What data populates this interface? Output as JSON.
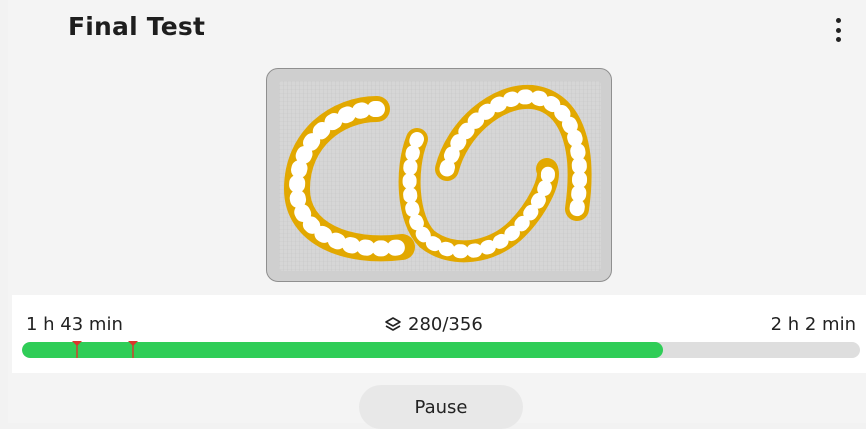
{
  "header": {
    "title": "Final Test",
    "menu_icon": "more-vertical-icon"
  },
  "preview": {
    "description_icon": "print-preview-image",
    "plate_color": "#cfcfcf",
    "model_color": "#e2a800"
  },
  "progress": {
    "elapsed": "1 h 43 min",
    "layers_icon": "layers-icon",
    "layers": "280/356",
    "layer_current": 280,
    "layer_total": 356,
    "remaining": "2 h 2 min",
    "fill_fraction": 0.765,
    "fill_color": "#2fcd57",
    "marker_color": "#d9362b",
    "markers_fraction": [
      0.066,
      0.133
    ]
  },
  "actions": {
    "pause_label": "Pause"
  }
}
